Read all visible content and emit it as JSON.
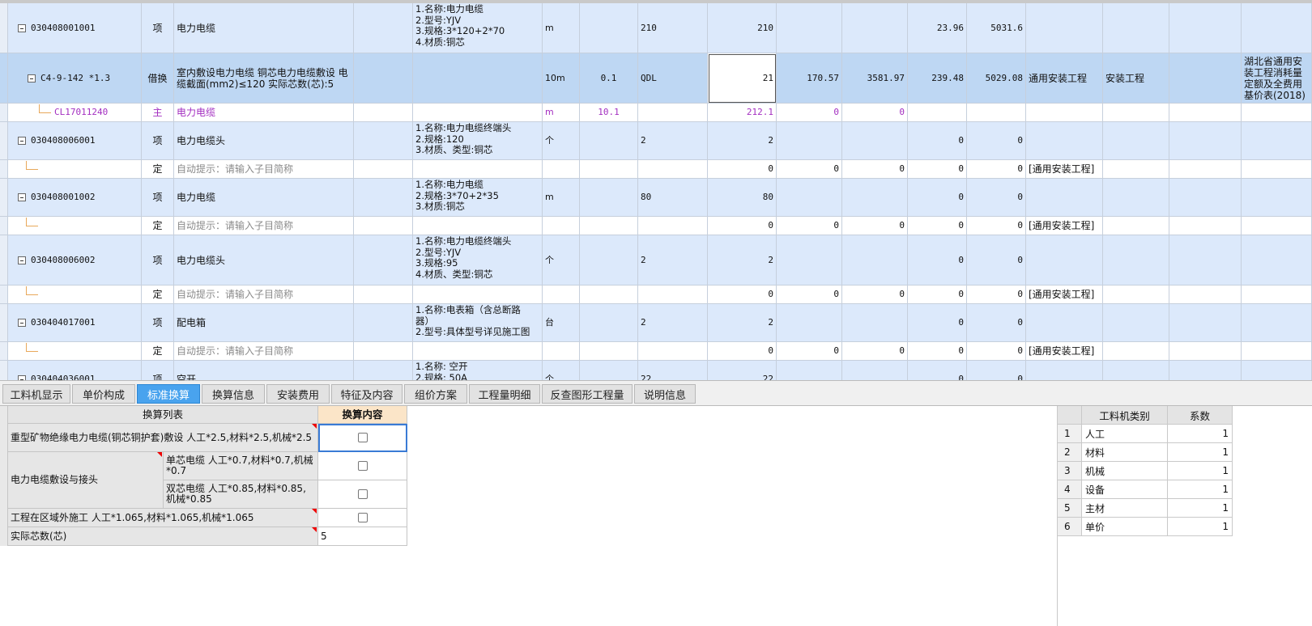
{
  "grid_rows": [
    {
      "kind": "blue",
      "code": "030408001001",
      "type": "项",
      "name": "电力电缆",
      "desc": "1.名称:电力电缆\n2.型号:YJV\n3.规格:3*120+2*70\n4.材质:铜芯",
      "unit": "m",
      "qty_expr": "",
      "coef": "210",
      "qty": "210",
      "c9": "",
      "c10": "",
      "c11": "23.96",
      "c12": "5031.6",
      "c13": "",
      "c14": "",
      "c15": "",
      "c16": ""
    },
    {
      "kind": "sel",
      "code": "C4-9-142 *1.3",
      "type": "借换",
      "name": "室内敷设电力电缆 铜芯电力电缆敷设 电缆截面(mm2)≤120  实际芯数(芯):5",
      "desc": "",
      "unit": "10m",
      "qty_expr": "0.1",
      "coef": "QDL",
      "qty": "21",
      "c9": "170.57",
      "c10": "3581.97",
      "c11": "239.48",
      "c12": "5029.08",
      "c13": "通用安装工程",
      "c14": "安装工程",
      "c15": "",
      "c16": "湖北省通用安装工程消耗量定额及全费用基价表(2018)"
    },
    {
      "kind": "white",
      "code": "CL17011240",
      "type": "主",
      "name": "电力电缆",
      "desc": "",
      "unit": "m",
      "qty_expr": "10.1",
      "coef": "",
      "qty": "212.1",
      "c9": "0",
      "c10": "0",
      "c11": "",
      "c12": "",
      "c13": "",
      "c14": "",
      "c15": "",
      "c16": ""
    },
    {
      "kind": "blue",
      "code": "030408006001",
      "type": "项",
      "name": "电力电缆头",
      "desc": "1.名称:电力电缆终端头\n2.规格:120\n3.材质、类型:铜芯",
      "unit": "个",
      "qty_expr": "",
      "coef": "2",
      "qty": "2",
      "c9": "",
      "c10": "",
      "c11": "0",
      "c12": "0",
      "c13": "",
      "c14": "",
      "c15": "",
      "c16": ""
    },
    {
      "kind": "white",
      "code": "",
      "type": "定",
      "name": "自动提示：请输入子目简称",
      "desc": "",
      "unit": "",
      "qty_expr": "",
      "coef": "",
      "qty": "0",
      "c9": "0",
      "c10": "0",
      "c11": "0",
      "c12": "0",
      "c13": "[通用安装工程]",
      "c14": "",
      "c15": "",
      "c16": ""
    },
    {
      "kind": "blue",
      "code": "030408001002",
      "type": "项",
      "name": "电力电缆",
      "desc": "1.名称:电力电缆\n2.规格:3*70+2*35\n3.材质:铜芯",
      "unit": "m",
      "qty_expr": "",
      "coef": "80",
      "qty": "80",
      "c9": "",
      "c10": "",
      "c11": "0",
      "c12": "0",
      "c13": "",
      "c14": "",
      "c15": "",
      "c16": ""
    },
    {
      "kind": "white",
      "code": "",
      "type": "定",
      "name": "自动提示：请输入子目简称",
      "desc": "",
      "unit": "",
      "qty_expr": "",
      "coef": "",
      "qty": "0",
      "c9": "0",
      "c10": "0",
      "c11": "0",
      "c12": "0",
      "c13": "[通用安装工程]",
      "c14": "",
      "c15": "",
      "c16": ""
    },
    {
      "kind": "blue",
      "code": "030408006002",
      "type": "项",
      "name": "电力电缆头",
      "desc": "1.名称:电力电缆终端头\n2.型号:YJV\n3.规格:95\n4.材质、类型:铜芯",
      "unit": "个",
      "qty_expr": "",
      "coef": "2",
      "qty": "2",
      "c9": "",
      "c10": "",
      "c11": "0",
      "c12": "0",
      "c13": "",
      "c14": "",
      "c15": "",
      "c16": ""
    },
    {
      "kind": "white",
      "code": "",
      "type": "定",
      "name": "自动提示：请输入子目简称",
      "desc": "",
      "unit": "",
      "qty_expr": "",
      "coef": "",
      "qty": "0",
      "c9": "0",
      "c10": "0",
      "c11": "0",
      "c12": "0",
      "c13": "[通用安装工程]",
      "c14": "",
      "c15": "",
      "c16": ""
    },
    {
      "kind": "blue",
      "code": "030404017001",
      "type": "项",
      "name": "配电箱",
      "desc": "1.名称:电表箱（含总断路\n器）\n2.型号:具体型号详见施工图",
      "unit": "台",
      "qty_expr": "",
      "coef": "2",
      "qty": "2",
      "c9": "",
      "c10": "",
      "c11": "0",
      "c12": "0",
      "c13": "",
      "c14": "",
      "c15": "",
      "c16": ""
    },
    {
      "kind": "white",
      "code": "",
      "type": "定",
      "name": "自动提示：请输入子目简称",
      "desc": "",
      "unit": "",
      "qty_expr": "",
      "coef": "",
      "qty": "0",
      "c9": "0",
      "c10": "0",
      "c11": "0",
      "c12": "0",
      "c13": "[通用安装工程]",
      "c14": "",
      "c15": "",
      "c16": ""
    },
    {
      "kind": "blue",
      "code": "030404036001",
      "type": "项",
      "name": "空开",
      "desc": "1.名称: 空开\n2.规格: 50A",
      "unit": "个",
      "qty_expr": "",
      "coef": "22",
      "qty": "22",
      "c9": "",
      "c10": "",
      "c11": "0",
      "c12": "0",
      "c13": "",
      "c14": "",
      "c15": "",
      "c16": ""
    }
  ],
  "tabs": [
    "工料机显示",
    "单价构成",
    "标准换算",
    "换算信息",
    "安装费用",
    "特征及内容",
    "组价方案",
    "工程量明细",
    "反查图形工程量",
    "说明信息"
  ],
  "active_tab": "标准换算",
  "conversion": {
    "header_list": "换算列表",
    "header_content": "换算内容",
    "row1": "重型矿物绝缘电力电缆(铜芯铜护套)敷设 人工*2.5,材料*2.5,机械*2.5",
    "row2_group": "电力电缆敷设与接头",
    "row2_sub1": "单芯电缆 人工*0.7,材料*0.7,机械*0.7",
    "row2_sub2": "双芯电缆 人工*0.85,材料*0.85,机械*0.85",
    "row3": "工程在区域外施工 人工*1.065,材料*1.065,机械*1.065",
    "row4": "实际芯数(芯)",
    "row4_value": "5"
  },
  "coef_table": {
    "header_type": "工料机类别",
    "header_coef": "系数",
    "rows": [
      {
        "idx": "1",
        "type": "人工",
        "coef": "1"
      },
      {
        "idx": "2",
        "type": "材料",
        "coef": "1"
      },
      {
        "idx": "3",
        "type": "机械",
        "coef": "1"
      },
      {
        "idx": "4",
        "type": "设备",
        "coef": "1"
      },
      {
        "idx": "5",
        "type": "主材",
        "coef": "1"
      },
      {
        "idx": "6",
        "type": "单价",
        "coef": "1"
      }
    ]
  },
  "colors": {
    "row_blue": "#dce9fb",
    "row_selected": "#bed7f3",
    "tab_active": "#49a3ee",
    "material_text": "#a32ec0",
    "hint_text": "#8a8a8a"
  }
}
